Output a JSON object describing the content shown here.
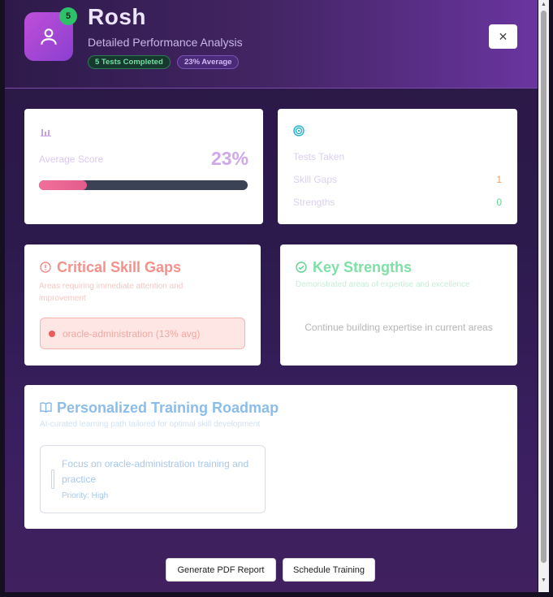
{
  "profile": {
    "name": "Rosh",
    "subtitle": "Detailed Performance Analysis",
    "badge_count": "5",
    "pill_tests": "5 Tests Completed",
    "pill_avg": "23% Average"
  },
  "score_card": {
    "label": "Average Score",
    "value": "23%",
    "progress": 0.23
  },
  "stats_card": {
    "tests_label": "Tests Taken",
    "gaps_label": "Skill Gaps",
    "gaps_value": "1",
    "strengths_label": "Strengths",
    "strengths_value": "0"
  },
  "gaps_card": {
    "title": "Critical Skill Gaps",
    "desc": "Areas requiring immediate attention and improvement",
    "item": "oracle-administration (13% avg)"
  },
  "strengths_card": {
    "title": "Key Strengths",
    "desc": "Demonstrated areas of expertise and excellence",
    "empty": "Continue building expertise in current areas"
  },
  "roadmap": {
    "title": "Personalized Training Roadmap",
    "desc": "AI-curated learning path tailored for optimal skill development",
    "item_title": "Focus on oracle-administration training and practice",
    "item_priority": "Priority: High"
  },
  "actions": {
    "pdf": "Generate PDF Report",
    "schedule": "Schedule Training"
  },
  "colors": {
    "accent": "#a24bd6",
    "gap": "#f07a7a",
    "strength": "#3fcf84",
    "roadmap": "#5a9ae0"
  }
}
